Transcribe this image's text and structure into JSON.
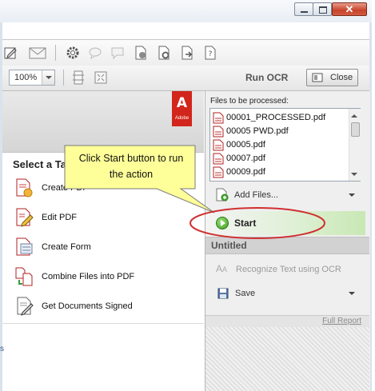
{
  "window": {
    "minimize_icon": "minimize-icon",
    "maximize_icon": "maximize-icon",
    "close_symbol": "✕"
  },
  "toolbar": {
    "icons": [
      "sign-icon",
      "email-icon",
      "gear-icon",
      "comment-icon",
      "sticky-note-icon",
      "pdf-settings-icon",
      "pdf-lock-icon",
      "pdf-export-icon",
      "pdf-help-icon"
    ],
    "zoom": "100%",
    "panel_title": "Run OCR",
    "close_label": "Close"
  },
  "adobe": {
    "logo_letter": "A",
    "wordmark": "Adobe"
  },
  "tasks": {
    "heading": "Select a Ta",
    "items": [
      {
        "label": "Create PDF",
        "icon": "create-pdf-icon"
      },
      {
        "label": "Edit PDF",
        "icon": "edit-pdf-icon"
      },
      {
        "label": "Create Form",
        "icon": "create-form-icon"
      },
      {
        "label": "Combine Files into PDF",
        "icon": "combine-files-icon"
      },
      {
        "label": "Get Documents Signed",
        "icon": "sign-document-icon"
      }
    ],
    "stub": "s"
  },
  "callout": {
    "line1": "Click Start button to run",
    "line2": "the action",
    "color": "#ffff99",
    "ellipse_color": "#d03030"
  },
  "ocr_panel": {
    "files_label": "Files to be processed:",
    "files": [
      "00001_PROCESSED.pdf",
      "00005 PWD.pdf",
      "00005.pdf",
      "00007.pdf",
      "00009.pdf"
    ],
    "add_files_label": "Add Files...",
    "start_label": "Start",
    "section_title": "Untitled",
    "recognize_label": "Recognize Text using OCR",
    "save_label": "Save",
    "full_report_label": "Full Report"
  }
}
